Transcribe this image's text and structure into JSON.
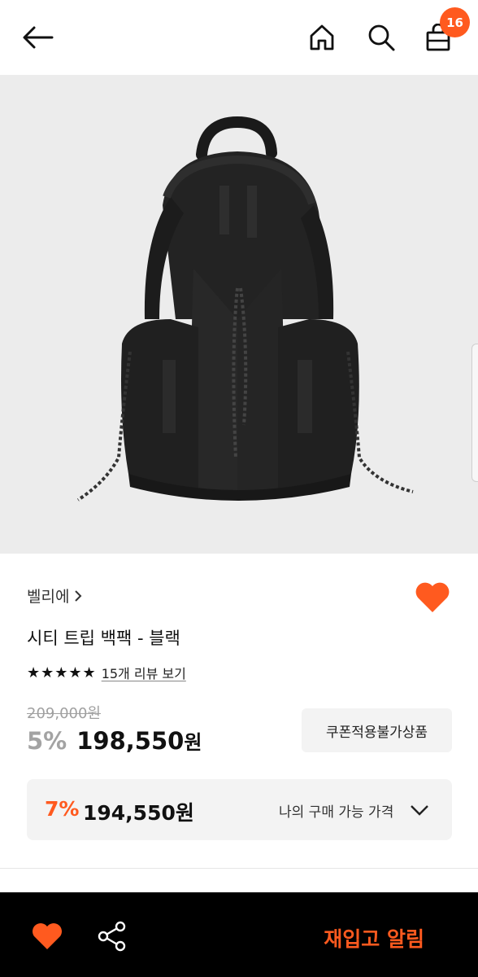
{
  "header": {
    "back_icon": "arrow-left-icon",
    "home_icon": "home-icon",
    "search_icon": "search-icon",
    "bag_icon": "shopping-bag-icon",
    "cart_count": "16"
  },
  "product": {
    "brand": "벨리에",
    "name": "시티 트립 백팩 - 블랙",
    "stars": "★★★★★",
    "review_link": "15개 리뷰 보기",
    "original_price": "209,000원",
    "discount_rate": "5%",
    "sale_price": "198,550",
    "sale_currency": "원",
    "coupon_note": "쿠폰적용불가상품",
    "image_icon": "backpack-image"
  },
  "my_price": {
    "rate": "7%",
    "price": "194,550원",
    "label": "나의 구매 가능 가격"
  },
  "bottom_bar": {
    "restock_label": "재입고 알림"
  },
  "colors": {
    "accent": "#ff5a1f",
    "bar_bg": "#000000",
    "hero_bg": "#ececec"
  }
}
